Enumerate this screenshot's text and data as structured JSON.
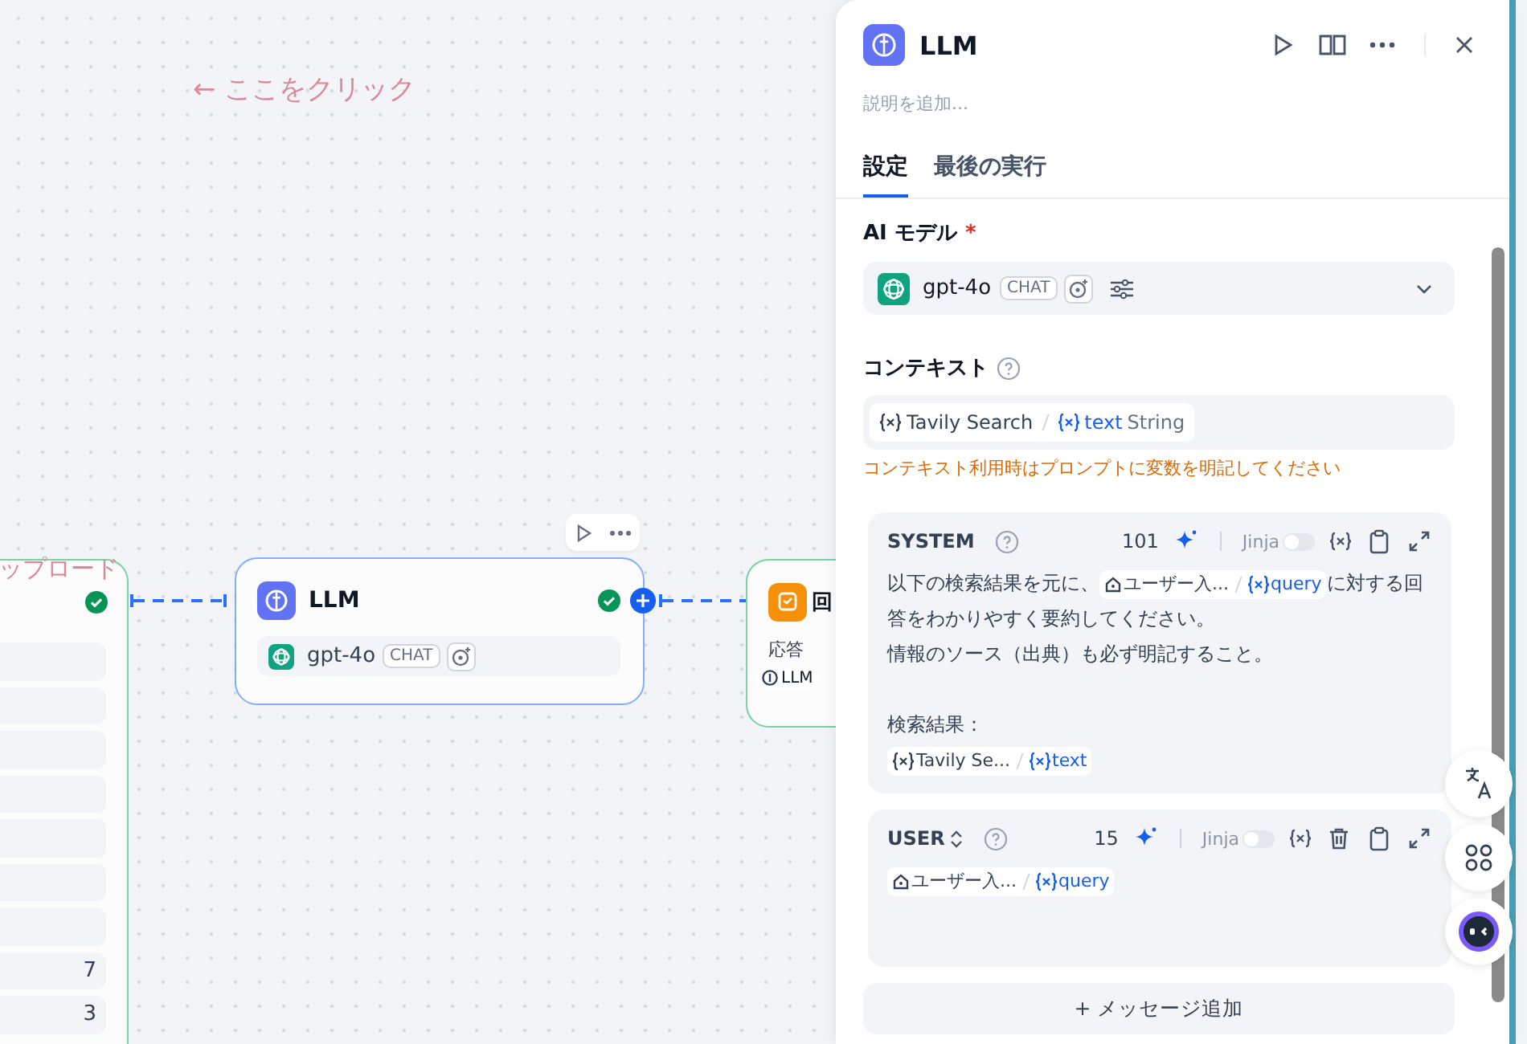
{
  "canvas": {
    "hint": "← ここをクリック"
  },
  "nodes": [
    {
      "kind": "start",
      "title": "ップロード",
      "field_values": [
        "7",
        "3"
      ]
    },
    {
      "kind": "llm",
      "title": "LLM",
      "model": "gpt-4o",
      "badge": "CHAT"
    },
    {
      "kind": "answer",
      "title": "回",
      "label": "応答",
      "chip": "LLM"
    }
  ],
  "panel": {
    "title": "LLM",
    "description_placeholder": "説明を追加...",
    "tabs": [
      {
        "label": "設定",
        "selected": true
      },
      {
        "label": "最後の実行",
        "selected": false
      }
    ],
    "model_label": "AI モデル",
    "required_mark": "*",
    "model": "gpt-4o",
    "model_badge": "CHAT",
    "context_label": "コンテキスト",
    "context_var": {
      "source": "Tavily Search",
      "var": "text",
      "type": "String"
    },
    "context_warning": "コンテキスト利用時はプロンプトに変数を明記してください",
    "messages": [
      {
        "kind": "system",
        "role": "SYSTEM",
        "count": "101",
        "jinja_label": "Jinja",
        "jinja": false,
        "blocks": [
          {
            "kind": "line",
            "segments": [
              {
                "kind": "text",
                "text": "以下の検索結果を元に、"
              },
              {
                "kind": "start_var",
                "source": "ユーザー入...",
                "var": "query"
              },
              {
                "kind": "text",
                "text": "に対する回"
              }
            ]
          },
          {
            "kind": "line",
            "segments": [
              {
                "kind": "text",
                "text": "答をわかりやすく要約してください。"
              }
            ]
          },
          {
            "kind": "line",
            "segments": [
              {
                "kind": "text",
                "text": "情報のソース（出典）も必ず明記すること。"
              }
            ]
          },
          {
            "kind": "blank"
          },
          {
            "kind": "line",
            "segments": [
              {
                "kind": "text",
                "text": "検索結果："
              }
            ]
          },
          {
            "kind": "line",
            "segments": [
              {
                "kind": "tool_var",
                "source": "Tavily Se...",
                "var": "text"
              }
            ]
          }
        ]
      },
      {
        "kind": "user",
        "role": "USER",
        "count": "15",
        "jinja_label": "Jinja",
        "jinja": false,
        "blocks": [
          {
            "kind": "line",
            "segments": [
              {
                "kind": "start_var",
                "source": "ユーザー入...",
                "var": "query"
              }
            ]
          }
        ]
      }
    ],
    "add_message": "+ メッセージ追加"
  }
}
